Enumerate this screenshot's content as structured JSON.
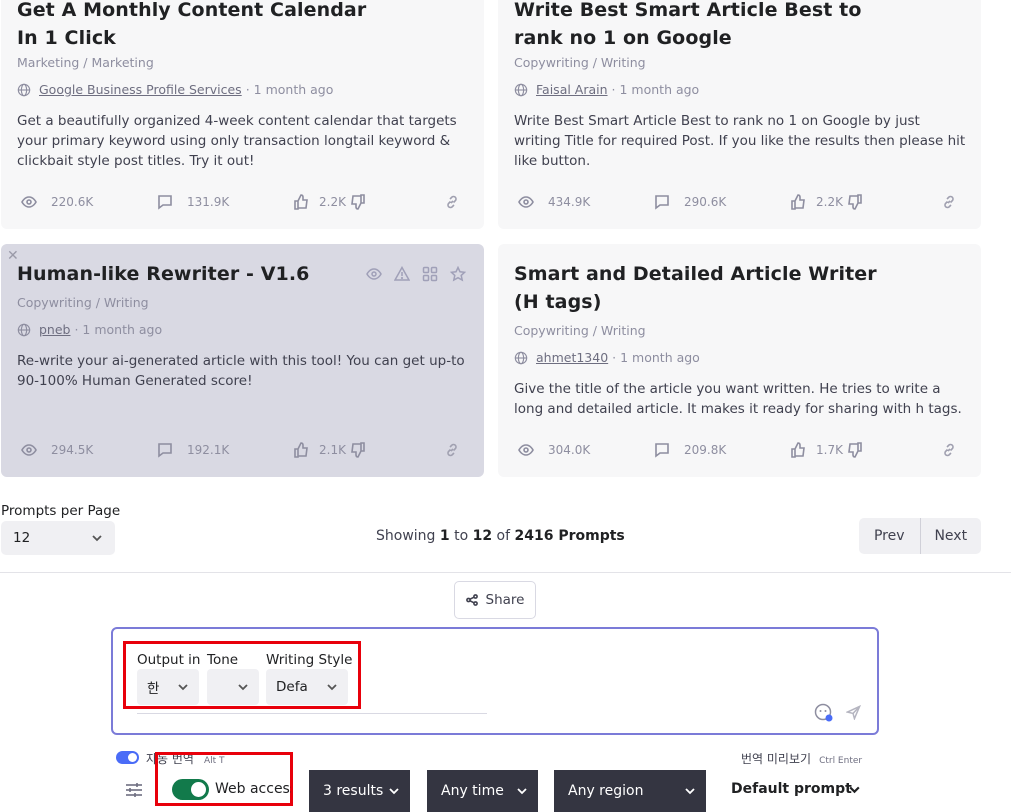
{
  "cards": [
    {
      "title": "Get A Monthly Content Calendar\nIn 1 Click",
      "title_line1": "Get A Monthly Content Calendar",
      "title_line2": "In 1 Click",
      "category": "Marketing / Marketing",
      "author": "Google Business Profile Services",
      "time": "· 1 month ago",
      "description": "Get a beautifully organized 4-week content calendar that targets your primary keyword using only transaction longtail keyword & clickbait style post titles. Try it out!",
      "views": "220.6K",
      "comments": "131.9K",
      "likes": "2.2K"
    },
    {
      "title_line1": "Write Best Smart Article Best to",
      "title_line2": "rank no 1 on Google",
      "category": "Copywriting / Writing",
      "author": "Faisal Arain",
      "time": "· 1 month ago",
      "description": "Write Best Smart Article Best to rank no 1 on Google by just writing Title for required Post. If you like the results then please hit like button.",
      "views": "434.9K",
      "comments": "290.6K",
      "likes": "2.2K"
    },
    {
      "title_line1": "Human-like Rewriter - V1.6",
      "category": "Copywriting / Writing",
      "author": "pneb",
      "time": "· 1 month ago",
      "description": "Re-write your ai-generated article with this tool! You can get up-to 90-100% Human Generated score!",
      "views": "294.5K",
      "comments": "192.1K",
      "likes": "2.1K"
    },
    {
      "title_line1": "Smart and Detailed Article Writer",
      "title_line2": "(H tags)",
      "category": "Copywriting / Writing",
      "author": "ahmet1340",
      "time": "· 1 month ago",
      "description": "Give the title of the article you want written. He tries to write a long and detailed article. It makes it ready for sharing with h tags.",
      "views": "304.0K",
      "comments": "209.8K",
      "likes": "1.7K"
    }
  ],
  "pagination": {
    "per_page_label": "Prompts per Page",
    "per_page_value": "12",
    "showing_prefix": "Showing",
    "from": "1",
    "to_word": "to",
    "to": "12",
    "of_word": "of",
    "total": "2416 Prompts",
    "prev": "Prev",
    "next": "Next"
  },
  "share_label": "Share",
  "composer": {
    "output_label": "Output in",
    "output_value": "한",
    "tone_label": "Tone",
    "tone_value": "",
    "style_label": "Writing Style",
    "style_value": "Defa"
  },
  "translation": {
    "auto_label": "자동 번역",
    "auto_shortcut": "Alt T",
    "preview_label": "번역 미리보기",
    "preview_shortcut": "Ctrl Enter"
  },
  "web": {
    "web_access_label": "Web access",
    "results": "3 results",
    "time": "Any time",
    "region": "Any region",
    "default_prompt": "Default prompt"
  },
  "colors": {
    "card_bg": "#f7f7f8",
    "card_hover_bg": "#d9d9e3",
    "composer_border": "#7b7bd8",
    "highlight_red": "#e8000b",
    "toggle_blue": "#4a6cf7",
    "toggle_green": "#127a4b",
    "dark_select": "#343541"
  }
}
